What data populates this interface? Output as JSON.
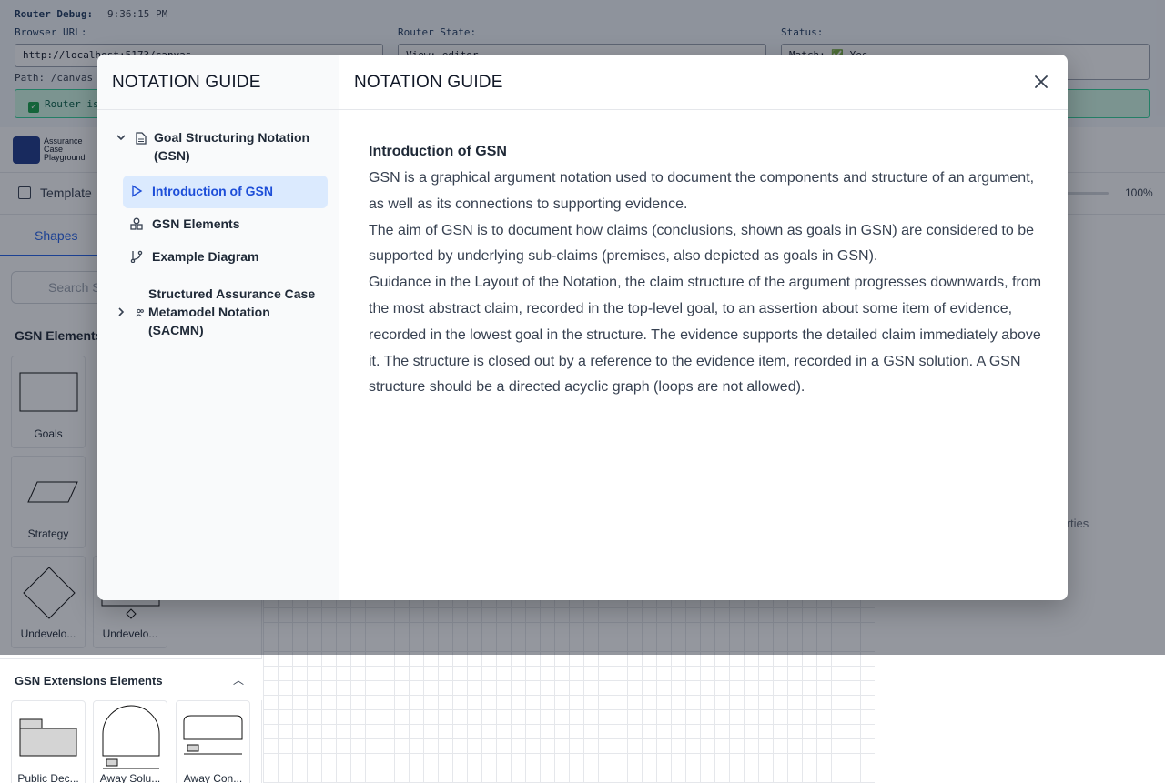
{
  "debug": {
    "title": "Router Debug:",
    "time": "9:36:15 PM",
    "browser_url_label": "Browser URL:",
    "browser_url_value": "http://localhost:5173/canvas",
    "router_state_label": "Router State:",
    "router_state_value": "View: editor",
    "status_label": "Status:",
    "status_value": "Match: ✅ Yes",
    "path": "Path: /canvas",
    "router_ok": "Router is working"
  },
  "app": {
    "logo_text": "Assurance Case Playground",
    "template_label": "Template",
    "zoom_label": "100%",
    "shapes_tab": "Shapes",
    "search_placeholder": "Search Shapes",
    "gsn_elements_title": "GSN Elements",
    "shapes": [
      "Goals",
      "Strategy",
      "Undevelo...",
      "Undevelo..."
    ],
    "ext_title": "GSN Extensions Elements",
    "ext_shapes": [
      "Public Dec...",
      "Away Solu...",
      "Away Con..."
    ],
    "properties_label": "operties"
  },
  "modal": {
    "side_title": "NOTATION GUIDE",
    "main_title": "NOTATION GUIDE",
    "nav": {
      "group1": "Goal Structuring Notation (GSN)",
      "items": [
        "Introduction of GSN",
        "GSN Elements",
        "Example Diagram"
      ],
      "group2": "Structured Assurance Case Metamodel Notation (SACMN)"
    },
    "content": {
      "heading": "Introduction of GSN",
      "p1": "GSN is a graphical argument notation used to document the components and structure of an argument, as well as its connections to supporting evidence.",
      "p2": "The aim of GSN is to document how claims (conclusions, shown as goals in GSN) are considered to be supported by underlying sub-claims (premises, also depicted as goals in GSN).",
      "p3": "Guidance in the Layout of the Notation, the claim structure of the argument progresses downwards, from the most abstract claim, recorded in the top-level goal, to an assertion about some item of evidence, recorded in the lowest goal in the structure. The evidence supports the detailed claim immediately above it. The structure is closed out by a reference to the evidence item, recorded in a GSN solution. A GSN structure should be a directed acyclic graph (loops are not allowed)."
    }
  },
  "colors": {
    "accent": "#2563eb",
    "active_bg": "#dbeafe",
    "overlay": "rgba(17,24,39,0.45)"
  }
}
